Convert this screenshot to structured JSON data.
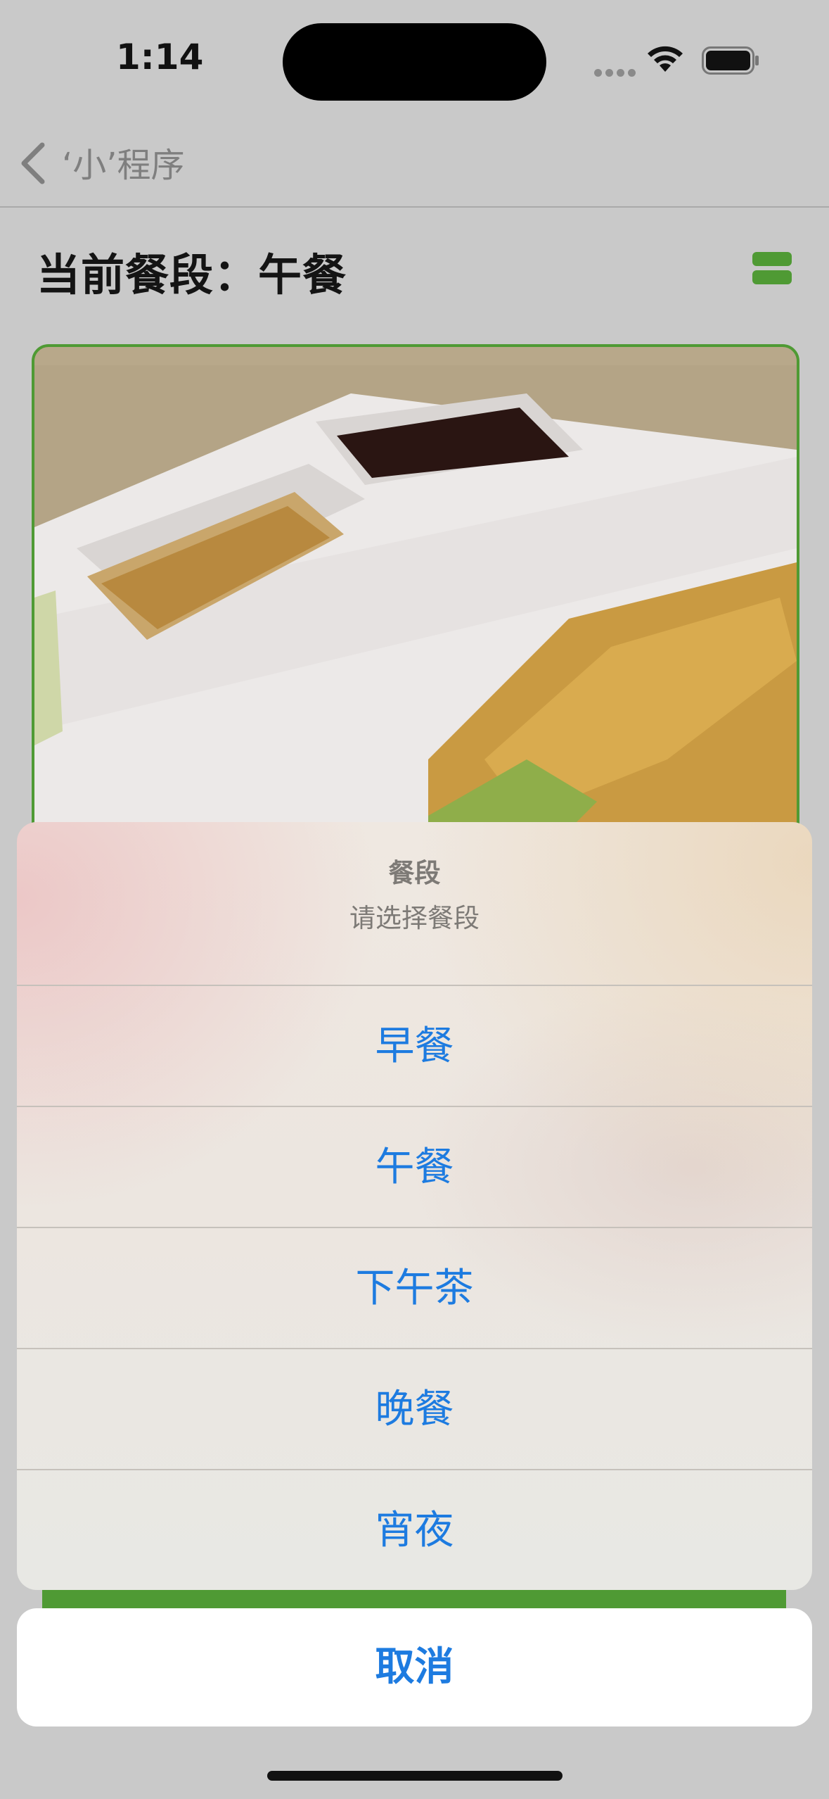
{
  "status_bar": {
    "time": "1:14"
  },
  "nav": {
    "back_title": "‘小’程序"
  },
  "meal_header": {
    "title": "当前餐段：午餐"
  },
  "accent_color": "#4f9a34",
  "action_sheet": {
    "title": "餐段",
    "subtitle": "请选择餐段",
    "options": [
      "早餐",
      "午餐",
      "下午茶",
      "晚餐",
      "宵夜"
    ],
    "cancel_label": "取消"
  },
  "icons": [
    "back-chevron-icon",
    "wifi-icon",
    "battery-icon",
    "list-toggle-icon"
  ]
}
